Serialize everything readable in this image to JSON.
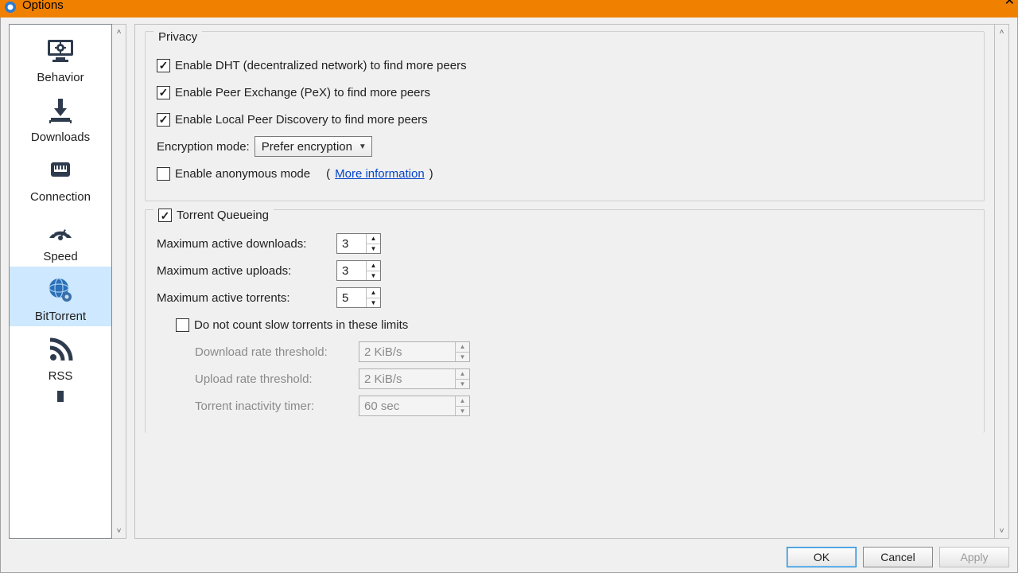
{
  "window": {
    "title": "Options"
  },
  "sidebar": {
    "items": [
      {
        "label": "Behavior"
      },
      {
        "label": "Downloads"
      },
      {
        "label": "Connection"
      },
      {
        "label": "Speed"
      },
      {
        "label": "BitTorrent"
      },
      {
        "label": "RSS"
      }
    ]
  },
  "privacy": {
    "legend": "Privacy",
    "dht_label": "Enable DHT (decentralized network) to find more peers",
    "pex_label": "Enable Peer Exchange (PeX) to find more peers",
    "lpd_label": "Enable Local Peer Discovery to find more peers",
    "enc_label": "Encryption mode:",
    "enc_value": "Prefer encryption",
    "anon_label": "Enable anonymous mode",
    "anon_more_open": "(",
    "anon_more_link": "More information",
    "anon_more_close": ")"
  },
  "queue": {
    "legend": "Torrent Queueing",
    "max_dl_label": "Maximum active downloads:",
    "max_dl_value": "3",
    "max_ul_label": "Maximum active uploads:",
    "max_ul_value": "3",
    "max_tr_label": "Maximum active torrents:",
    "max_tr_value": "5",
    "slow_label": "Do not count slow torrents in these limits",
    "dl_rate_label": "Download rate threshold:",
    "dl_rate_value": "2 KiB/s",
    "ul_rate_label": "Upload rate threshold:",
    "ul_rate_value": "2 KiB/s",
    "inact_label": "Torrent inactivity timer:",
    "inact_value": "60 sec"
  },
  "buttons": {
    "ok": "OK",
    "cancel": "Cancel",
    "apply": "Apply"
  }
}
